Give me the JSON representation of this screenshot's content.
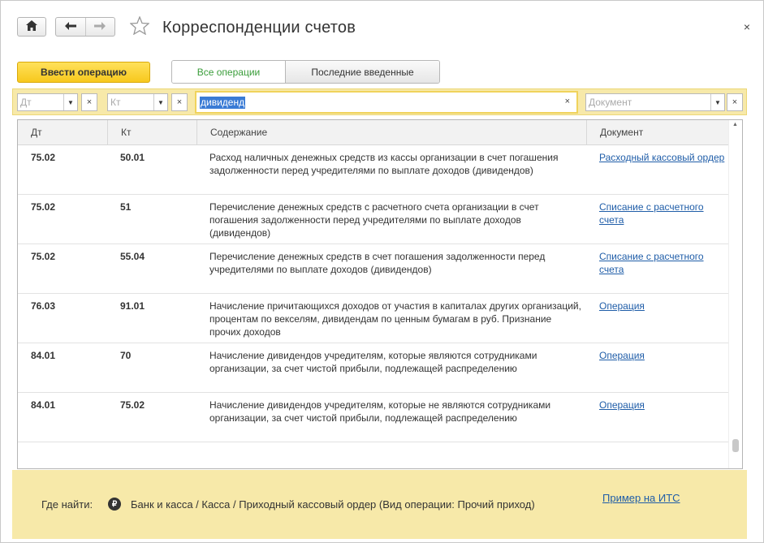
{
  "window": {
    "title": "Корреспонденции счетов",
    "close_glyph": "×"
  },
  "toolbar": {
    "enter_operation_label": "Ввести операцию",
    "tabs": [
      {
        "label": "Все операции",
        "active": true
      },
      {
        "label": "Последние введенные",
        "active": false
      }
    ]
  },
  "filters": {
    "dt_placeholder": "Дт",
    "kt_placeholder": "Кт",
    "search_value": "дивиденд",
    "document_placeholder": "Документ",
    "clear_glyph": "×",
    "dropdown_glyph": "▼"
  },
  "table": {
    "columns": [
      "Дт",
      "Кт",
      "Содержание",
      "Документ"
    ],
    "rows": [
      {
        "dt": "75.02",
        "kt": "50.01",
        "description": "Расход наличных денежных средств из кассы организации в счет погашения задолженности перед учредителями по выплате доходов (дивидендов)",
        "document": "Расходный кассовый ордер"
      },
      {
        "dt": "75.02",
        "kt": "51",
        "description": "Перечисление денежных средств с расчетного счета организации в счет погашения задолженности перед учредителями по выплате доходов (дивидендов)",
        "document": "Списание с расчетного счета"
      },
      {
        "dt": "75.02",
        "kt": "55.04",
        "description": "Перечисление денежных средств в счет погашения задолженности перед учредителями по выплате доходов (дивидендов)",
        "document": "Списание с расчетного счета"
      },
      {
        "dt": "76.03",
        "kt": "91.01",
        "description": "Начисление причитающихся доходов от участия в капиталах других организаций, процентам по векселям, дивидендам по ценным бумагам в руб. Признание прочих доходов",
        "document": "Операция"
      },
      {
        "dt": "84.01",
        "kt": "70",
        "description": "Начисление дивидендов учредителям, которые являются сотрудниками организации, за счет чистой прибыли, подлежащей распределению",
        "document": "Операция"
      },
      {
        "dt": "84.01",
        "kt": "75.02",
        "description": "Начисление дивидендов учредителям, которые не являются сотрудниками организации, за счет чистой прибыли, подлежащей распределению",
        "document": "Операция"
      }
    ]
  },
  "footer": {
    "where_label": "Где найти:",
    "icon_glyph": "₽",
    "path": "Банк и касса / Касса / Приходный кассовый ордер (Вид операции: Прочий приход)",
    "its_link": "Пример на ИТС"
  },
  "icons": {
    "home": "home-icon",
    "back": "arrow-left-icon",
    "forward": "arrow-right-icon",
    "favorite": "star-icon",
    "ruble": "ruble-icon"
  },
  "colors": {
    "accent_yellow": "#f7c81d",
    "panel_yellow": "#f7e9a9",
    "link_blue": "#1f5da8",
    "active_tab_green": "#3a9d3a",
    "selection_blue": "#3a7bd5"
  }
}
